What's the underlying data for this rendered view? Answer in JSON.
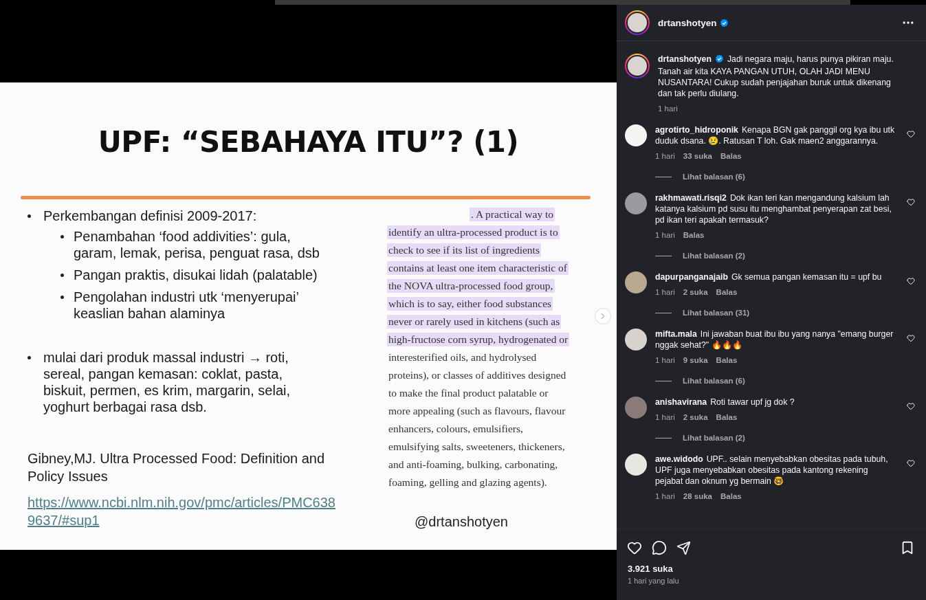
{
  "slide": {
    "title": "UPF: “SEBAHAYA ITU”? (1)",
    "bullets": [
      {
        "text": "Perkembangan definisi 2009-2017:",
        "children": [
          {
            "text": "Penambahan ‘food addivities’: gula, garam, lemak, perisa, penguat rasa, dsb"
          },
          {
            "text": "Pangan praktis, disukai lidah (palatable)"
          },
          {
            "text": "Pengolahan industri utk ‘menyerupai’ keaslian bahan alaminya"
          }
        ]
      },
      {
        "text": "mulai dari produk massal industri → roti, sereal, pangan kemasan: coklat, pasta, biskuit, permen, es krim, margarin, selai, yoghurt berbagai rasa dsb."
      }
    ],
    "reference": "Gibney,MJ. Ultra Processed Food: Definition and Policy Issues",
    "link": "https://www.ncbi.nlm.nih.gov/pmc/articles/PMC6389637/#sup1",
    "quote_lines": [
      {
        "text": ". A practical way to",
        "highlighted": true
      },
      {
        "text": "identify an ultra-processed product is to",
        "highlighted": true
      },
      {
        "text": "check to see if its list of ingredients",
        "highlighted": true
      },
      {
        "text": "contains at least one item characteristic of",
        "highlighted": true
      },
      {
        "text": "the NOVA ultra-processed food group,",
        "highlighted": true
      },
      {
        "text": "which is to say, either food substances",
        "highlighted": true
      },
      {
        "text": "never or rarely used in kitchens (such as",
        "highlighted": true
      },
      {
        "text": "high-fructose corn syrup, hydrogenated or",
        "highlighted": true
      },
      {
        "text": "interesterified oils, and hydrolysed",
        "highlighted": false
      },
      {
        "text": "proteins), or classes of additives designed",
        "highlighted": false
      },
      {
        "text": "to make the final product palatable or",
        "highlighted": false
      },
      {
        "text": "more appealing (such as flavours, flavour",
        "highlighted": false
      },
      {
        "text": "enhancers, colours, emulsifiers,",
        "highlighted": false
      },
      {
        "text": "emulsifying salts, sweeteners, thickeners,",
        "highlighted": false
      },
      {
        "text": "and anti-foaming, bulking, carbonating,",
        "highlighted": false
      },
      {
        "text": "foaming, gelling and glazing agents).",
        "highlighted": false
      }
    ],
    "handle": "@drtanshotyen"
  },
  "post": {
    "username": "drtanshotyen",
    "verified": true,
    "caption_username": "drtanshotyen",
    "caption": "Jadi negara maju, harus punya pikiran maju. Tanah air kita KAYA PANGAN UTUH, OLAH JADI MENU NUSANTARA! Cukup sudah penjajahan buruk untuk dikenang dan tak perlu diulang.",
    "caption_time": "1 hari",
    "comments": [
      {
        "username": "agrotirto_hidroponik",
        "text": "Kenapa BGN gak panggil org kya ibu utk duduk dsana. 😢. Ratusan T loh. Gak maen2 anggarannya.",
        "time": "1 hari",
        "likes": "33 suka",
        "reply": "Balas",
        "replies": "Lihat balasan (6)",
        "color": "#f4f6f4"
      },
      {
        "username": "rakhmawati.risqi2",
        "text": "Dok ikan teri kan mengandung kalsium lah katanya kalsium pd susu itu menghambat penyerapan zat besi, pd ikan teri apakah termasuk?",
        "time": "1 hari",
        "reply": "Balas",
        "replies": "Lihat balasan (2)",
        "color": "#9c9aa0"
      },
      {
        "username": "dapurpanganajaib",
        "text": "Gk semua pangan kemasan itu = upf bu",
        "time": "1 hari",
        "likes": "2 suka",
        "reply": "Balas",
        "replies": "Lihat balasan (31)",
        "color": "#b8a890"
      },
      {
        "username": "mifta.mala",
        "text": "Ini jawaban buat ibu ibu yang nanya \"emang burger nggak sehat?\" 🔥🔥🔥",
        "time": "1 hari",
        "likes": "9 suka",
        "reply": "Balas",
        "replies": "Lihat balasan (6)",
        "color": "#d8d2cc"
      },
      {
        "username": "anishavirana",
        "text": "Roti tawar upf jg dok ?",
        "time": "1 hari",
        "likes": "2 suka",
        "reply": "Balas",
        "replies": "Lihat balasan (2)",
        "color": "#8a7a78"
      },
      {
        "username": "awe.widodo",
        "text": "UPF.. selain menyebabkan obesitas pada tubuh, UPF juga menyebabkan obesitas pada kantong rekening pejabat dan oknum yg bermain 🤓",
        "time": "1 hari",
        "likes": "28 suka",
        "reply": "Balas",
        "color": "#e6e8e2"
      }
    ],
    "likes": "3.921 suka",
    "posted": "1 hari yang lalu"
  }
}
